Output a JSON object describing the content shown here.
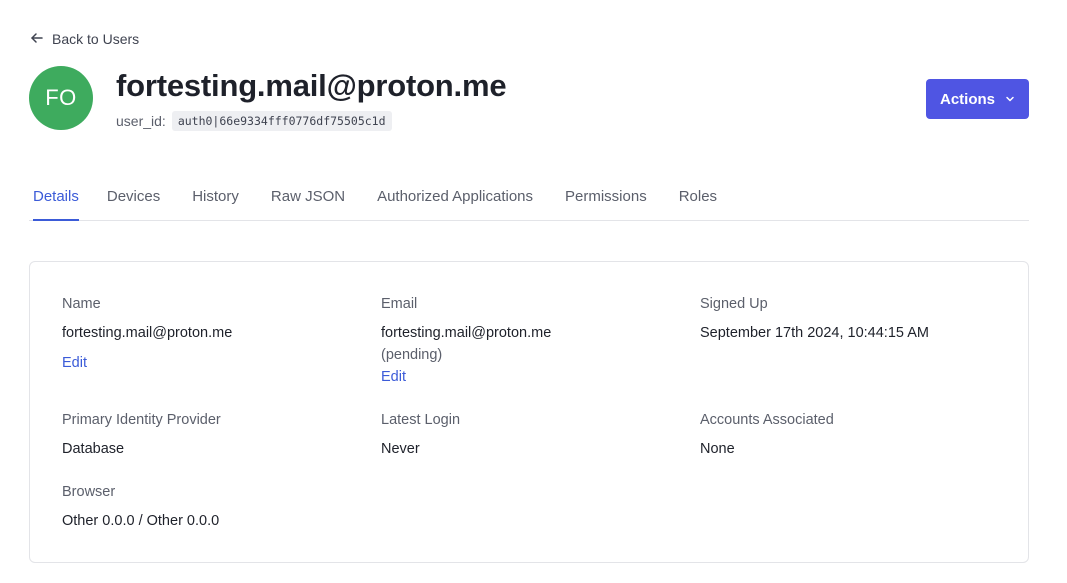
{
  "nav": {
    "back_label": "Back to Users"
  },
  "user": {
    "avatar_initials": "FO",
    "title": "fortesting.mail@proton.me",
    "user_id_label": "user_id:",
    "user_id_value": "auth0|66e9334fff0776df75505c1d"
  },
  "actions": {
    "label": "Actions"
  },
  "tabs": [
    {
      "label": "Details",
      "active": true
    },
    {
      "label": "Devices"
    },
    {
      "label": "History"
    },
    {
      "label": "Raw JSON"
    },
    {
      "label": "Authorized Applications"
    },
    {
      "label": "Permissions"
    },
    {
      "label": "Roles"
    }
  ],
  "details": {
    "name": {
      "label": "Name",
      "value": "fortesting.mail@proton.me",
      "edit": "Edit"
    },
    "email": {
      "label": "Email",
      "value": "fortesting.mail@proton.me",
      "status": "(pending)",
      "edit": "Edit"
    },
    "signed_up": {
      "label": "Signed Up",
      "value": "September 17th 2024, 10:44:15 AM"
    },
    "primary_identity_provider": {
      "label": "Primary Identity Provider",
      "value": "Database"
    },
    "latest_login": {
      "label": "Latest Login",
      "value": "Never"
    },
    "accounts_associated": {
      "label": "Accounts Associated",
      "value": "None"
    },
    "browser": {
      "label": "Browser",
      "value": "Other 0.0.0 / Other 0.0.0"
    }
  },
  "colors": {
    "accent": "#4f55e3",
    "link": "#3b5bd8",
    "avatar_bg": "#3eab5e"
  },
  "icons": {
    "back": "arrow-left-icon",
    "actions": "chevron-down-icon"
  }
}
